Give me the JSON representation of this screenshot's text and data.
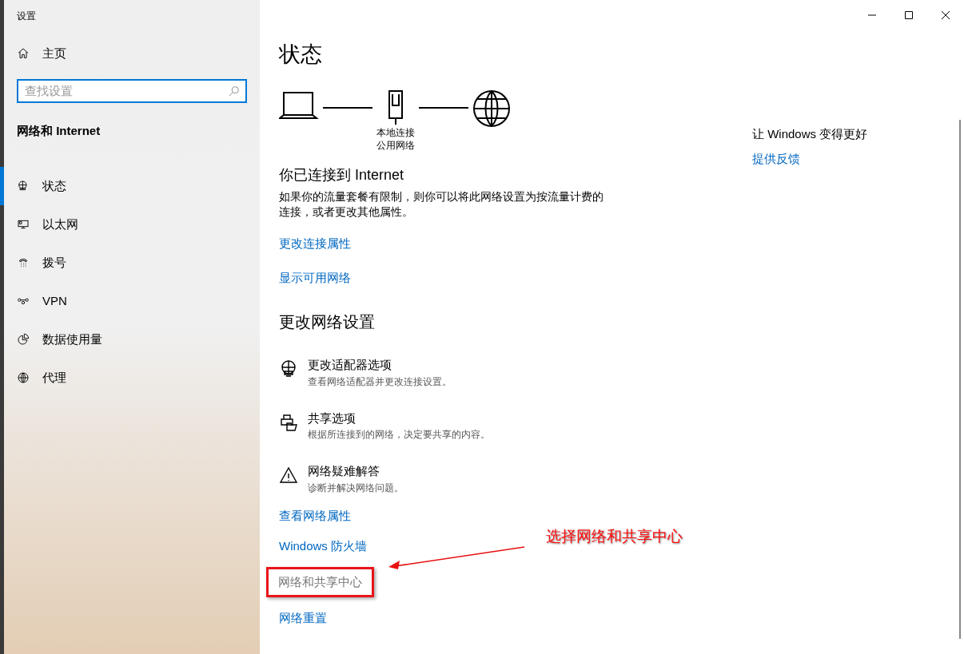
{
  "window": {
    "title": "设置"
  },
  "sidebar": {
    "home": "主页",
    "search": {
      "placeholder": "查找设置"
    },
    "section": "网络和 Internet",
    "items": [
      {
        "label": "状态",
        "selected": true
      },
      {
        "label": "以太网",
        "selected": false
      },
      {
        "label": "拨号",
        "selected": false
      },
      {
        "label": "VPN",
        "selected": false
      },
      {
        "label": "数据使用量",
        "selected": false
      },
      {
        "label": "代理",
        "selected": false
      }
    ]
  },
  "main": {
    "title": "状态",
    "diagram": {
      "labels": [
        "本地连接",
        "公用网络"
      ]
    },
    "status": {
      "heading": "你已连接到 Internet",
      "text": "如果你的流量套餐有限制，则你可以将此网络设置为按流量计费的连接，或者更改其他属性。"
    },
    "links": [
      {
        "label": "更改连接属性",
        "hovered": false
      },
      {
        "label": "显示可用网络",
        "hovered": false
      }
    ],
    "section_title": "更改网络设置",
    "options": [
      {
        "title": "更改适配器选项",
        "description": "查看网络适配器并更改连接设置。"
      },
      {
        "title": "共享选项",
        "description": "根据所连接到的网络，决定要共享的内容。"
      },
      {
        "title": "网络疑难解答",
        "description": "诊断并解决网络问题。"
      }
    ],
    "more_links": [
      {
        "label": "查看网络属性",
        "hovered": false
      },
      {
        "label": "Windows 防火墙",
        "hovered": false
      },
      {
        "label": "网络和共享中心",
        "hovered": true
      },
      {
        "label": "网络重置",
        "hovered": false
      }
    ]
  },
  "aside": {
    "heading": "让 Windows 变得更好",
    "link": "提供反馈"
  },
  "annotation": {
    "text": "选择网络和共享中心"
  }
}
